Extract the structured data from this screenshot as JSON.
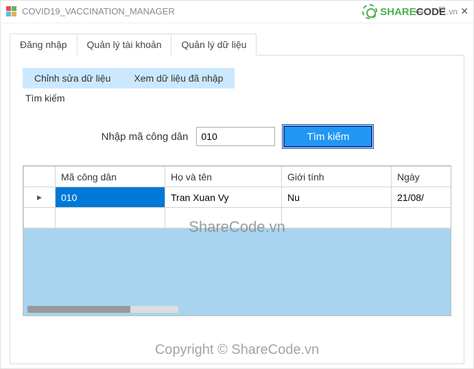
{
  "window": {
    "title": "COVID19_VACCINATION_MANAGER"
  },
  "watermark": {
    "brand_green": "SHARE",
    "brand_rest": "CODE",
    "brand_ext": ".vn",
    "center_text": "ShareCode.vn",
    "copyright": "Copyright © ShareCode.vn"
  },
  "tabs": {
    "t0": "Đăng nhập",
    "t1": "Quản lý tài khoản",
    "t2": "Quản lý dữ liệu"
  },
  "subtabs": {
    "s0": "Chỉnh sửa dữ liệu",
    "s1": "Xem dữ liệu đã nhập",
    "section": "Tìm kiếm"
  },
  "search": {
    "label": "Nhập mã công dân",
    "value": "010",
    "button": "Tìm kiếm"
  },
  "grid": {
    "headers": {
      "c0": "Mã công dân",
      "c1": "Họ và tên",
      "c2": "Giới tính",
      "c3": "Ngày"
    },
    "rows": [
      {
        "indicator": "▸",
        "c0": "010",
        "c1": "Tran Xuan Vy",
        "c2": "Nu",
        "c3": "21/08/"
      }
    ]
  }
}
